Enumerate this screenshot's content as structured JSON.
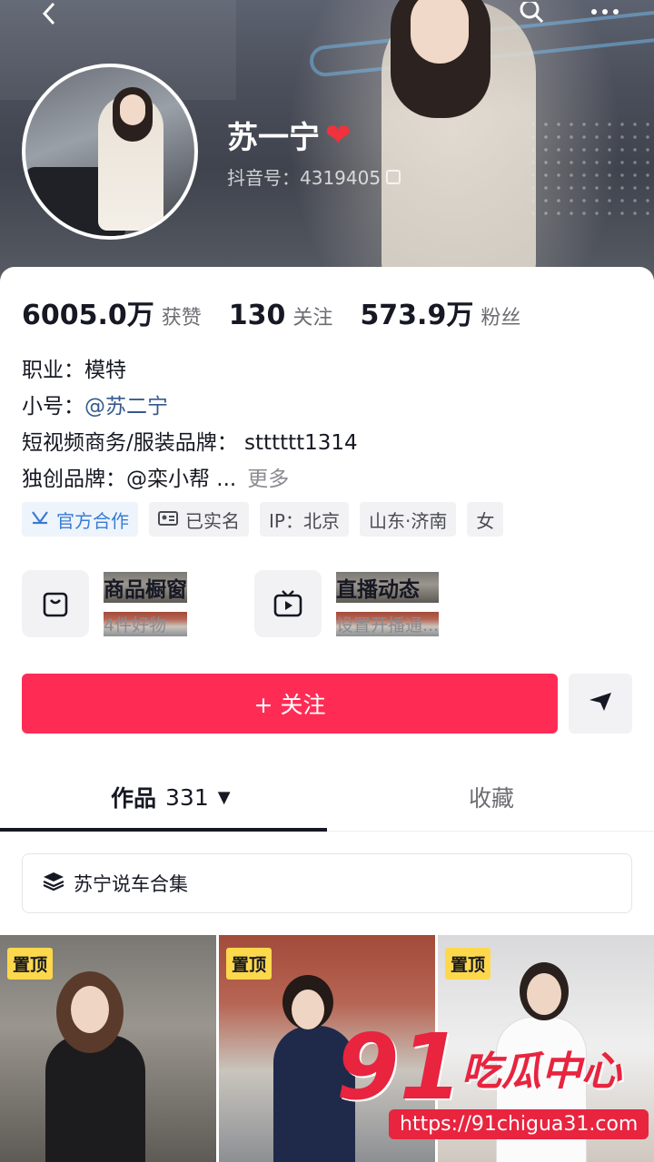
{
  "header": {
    "nickname": "苏一宁",
    "heart": "❤",
    "douyin_id": "抖音号：4319405"
  },
  "stats": [
    {
      "value": "6005.0万",
      "label": "获赞"
    },
    {
      "value": "130",
      "label": "关注"
    },
    {
      "value": "573.9万",
      "label": "粉丝"
    }
  ],
  "bio": {
    "occupation": "职业：模特",
    "alt_prefix": "小号：",
    "alt_account": "@苏二宁",
    "business": "短视频商务/服装品牌： stttttt1314",
    "brand": "独创品牌：@栾小帮 ...",
    "more": "更多"
  },
  "tags": [
    "官方合作",
    "已实名",
    "IP：北京",
    "山东·济南",
    "女"
  ],
  "features": [
    {
      "title": "商品橱窗",
      "subtitle": "4件好物"
    },
    {
      "title": "直播动态",
      "subtitle": "设置开播通..."
    }
  ],
  "follow_label": "+ 关注",
  "tabs": {
    "works_label": "作品",
    "works_count": "331",
    "favorites_label": "收藏"
  },
  "collection_label": "苏宁说车合集",
  "videos": [
    {
      "badge": "置顶"
    },
    {
      "badge": "置顶"
    },
    {
      "badge": "置顶"
    }
  ],
  "watermark": {
    "number": "91",
    "text": "吃瓜中心",
    "url": "https://91chigua31.com"
  },
  "colors": {
    "accent": "#fe2c55",
    "link": "#36598c",
    "badge": "#fdd84c",
    "watermark": "#e8243f"
  }
}
